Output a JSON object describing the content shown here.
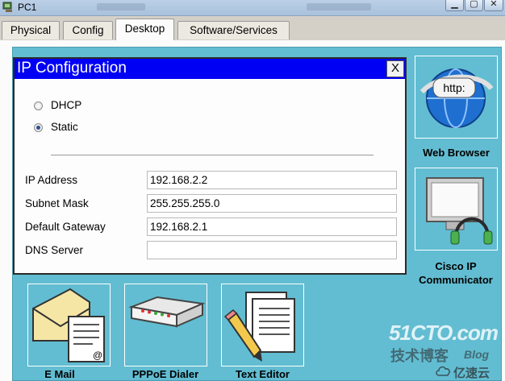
{
  "window": {
    "title": "PC1",
    "app_icon": "packet-tracer-pc-icon",
    "controls": {
      "minimize_icon": "minimize-icon",
      "maximize_icon": "maximize-icon",
      "close_icon": "close-icon"
    }
  },
  "tabs": [
    {
      "label": "Physical",
      "active": false
    },
    {
      "label": "Config",
      "active": false
    },
    {
      "label": "Desktop",
      "active": true
    },
    {
      "label": "Software/Services",
      "active": false
    }
  ],
  "apps": {
    "web_browser": {
      "label": "Web Browser",
      "icon": "web-browser-icon",
      "icon_text": "http:"
    },
    "cisco_ip_communicator": {
      "label_line1": "Cisco IP",
      "label_line2": "Communicator",
      "icon": "ip-communicator-icon"
    },
    "email": {
      "label": "E Mail",
      "icon": "email-icon",
      "icon_text": "@"
    },
    "pppoe_dialer": {
      "label": "PPPoE Dialer",
      "icon": "pppoe-dialer-icon"
    },
    "text_editor": {
      "label": "Text Editor",
      "icon": "text-editor-icon"
    }
  },
  "dialog": {
    "title": "IP Configuration",
    "close_label": "X",
    "mode_options": [
      {
        "label": "DHCP",
        "checked": false
      },
      {
        "label": "Static",
        "checked": true
      }
    ],
    "fields": {
      "ip_address": {
        "label": "IP Address",
        "value": "192.168.2.2"
      },
      "subnet_mask": {
        "label": "Subnet Mask",
        "value": "255.255.255.0"
      },
      "default_gateway": {
        "label": "Default Gateway",
        "value": "192.168.2.1"
      },
      "dns_server": {
        "label": "DNS Server",
        "value": ""
      }
    }
  },
  "watermark": {
    "main": "51CTO.com",
    "sub": "技术博客",
    "blog": "Blog",
    "brand": "亿速云"
  },
  "colors": {
    "dialog_title_bar": "#0000F5",
    "desktop_background": "#62BDD2",
    "tab_active": "#FBFBFB"
  }
}
